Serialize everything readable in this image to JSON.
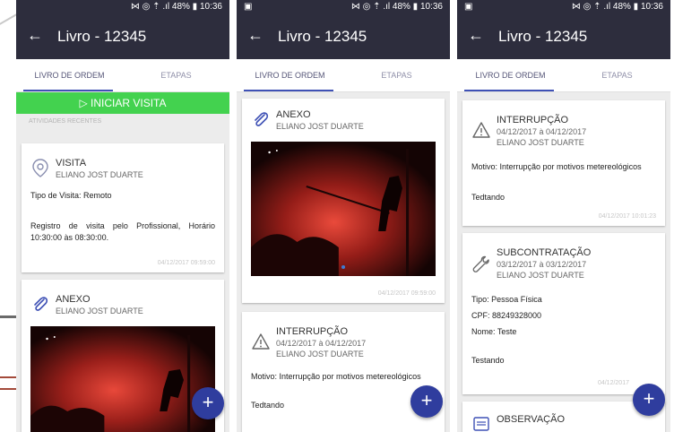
{
  "status": {
    "right": "⋈ ◎ ⇡ .ıl 48% ▮ 10:36",
    "left_icon": "▣"
  },
  "app": {
    "back_icon": "←",
    "title": "Livro - 12345"
  },
  "tabs": {
    "ordem": "LIVRO DE ORDEM",
    "etapas": "ETAPAS"
  },
  "screen1": {
    "start_button": "▷ INICIAR VISITA",
    "section_label": "ATIVIDADES RECENTES",
    "visita": {
      "title": "VISITA",
      "author": "ELIANO JOST DUARTE",
      "tipo": "Tipo de Visita: Remoto",
      "registro": "Registro de visita pelo Profissional, Horário 10:30:00 às 08:30:00.",
      "stamp": "04/12/2017 09:59:00"
    },
    "anexo": {
      "title": "ANEXO",
      "author": "ELIANO JOST DUARTE"
    }
  },
  "screen2": {
    "anexo": {
      "title": "ANEXO",
      "author": "ELIANO JOST DUARTE",
      "stamp": "04/12/2017 09:59:00"
    },
    "interrupcao": {
      "title": "INTERRUPÇÃO",
      "dates": "04/12/2017 à 04/12/2017",
      "author": "ELIANO JOST DUARTE",
      "motivo": "Motivo: Interrupção por motivos metereológicos",
      "text": "Tedtando"
    }
  },
  "screen3": {
    "interrupcao": {
      "title": "INTERRUPÇÃO",
      "dates": "04/12/2017 à 04/12/2017",
      "author": "ELIANO JOST DUARTE",
      "motivo": "Motivo: Interrupção por motivos metereológicos",
      "text": "Tedtando",
      "stamp": "04/12/2017 10:01:23"
    },
    "subcontratacao": {
      "title": "SUBCONTRATAÇÃO",
      "dates": "03/12/2017 à 03/12/2017",
      "author": "ELIANO JOST DUARTE",
      "tipo": "Tipo: Pessoa Física",
      "cpf": "CPF: 88249328000",
      "nome": "Nome: Teste",
      "text": "Testando",
      "stamp": "04/12/2017"
    },
    "observacao": {
      "title": "OBSERVAÇÃO"
    }
  },
  "fab_icon": "+",
  "colors": {
    "appbar": "#2d2d3d",
    "accent": "#3f51b5",
    "start_green": "#43d24f",
    "fab": "#2f3d9e"
  }
}
